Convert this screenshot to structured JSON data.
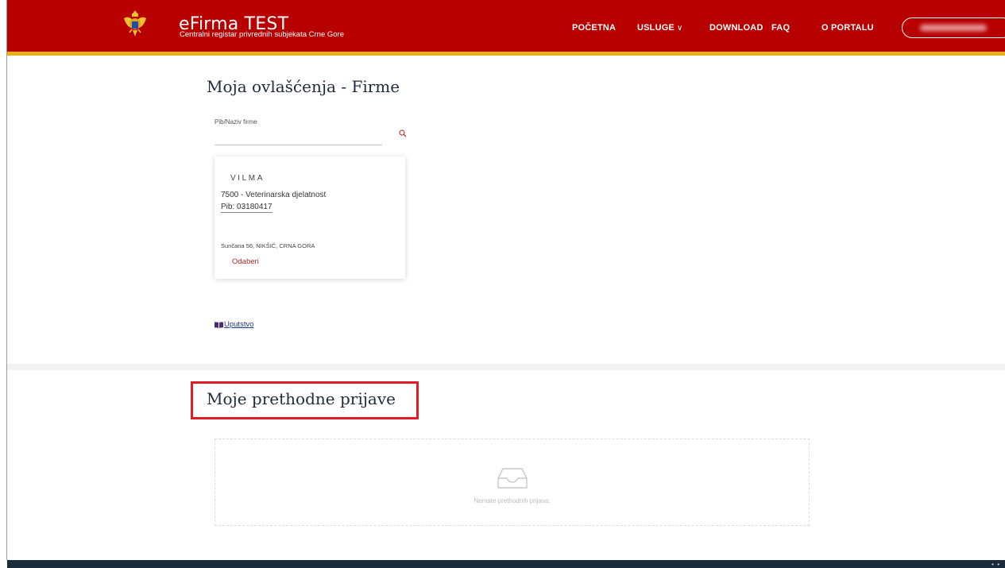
{
  "header": {
    "brand_title": "eFirma TEST",
    "brand_subtitle": "Centralni registar privrednih subjekata Crne Gore",
    "nav": [
      {
        "label": "POČETNA"
      },
      {
        "label": "USLUGE"
      },
      {
        "label": "DOWNLOAD"
      },
      {
        "label": "FAQ"
      },
      {
        "label": "O PORTALU"
      }
    ],
    "services_chevron": "∨"
  },
  "main": {
    "title": "Moja ovlašćenja - Firme",
    "search": {
      "label": "Pib/Naziv firme",
      "value": ""
    },
    "company": {
      "name": "VILMA",
      "activity": "7500 - Veterinarska djelatnost",
      "pib": "Pib: 03180417",
      "address": "Sunčana 56, NIKŠIĆ, CRNA GORA",
      "select_label": "Odaberi"
    },
    "guide_label": "Uputstvo"
  },
  "previous": {
    "title": "Moje prethodne prijave",
    "empty_message": "Nemate prethodnih prijava."
  },
  "colors": {
    "header_bg": "#b80000",
    "header_accent": "#e7b218",
    "highlight_border": "#e01d24",
    "link_red": "#b22a2a",
    "footer_bg": "#1a2b3c"
  },
  "icons": [
    "coat-of-arms-logo",
    "search-icon",
    "book-icon",
    "empty-inbox-icon"
  ]
}
